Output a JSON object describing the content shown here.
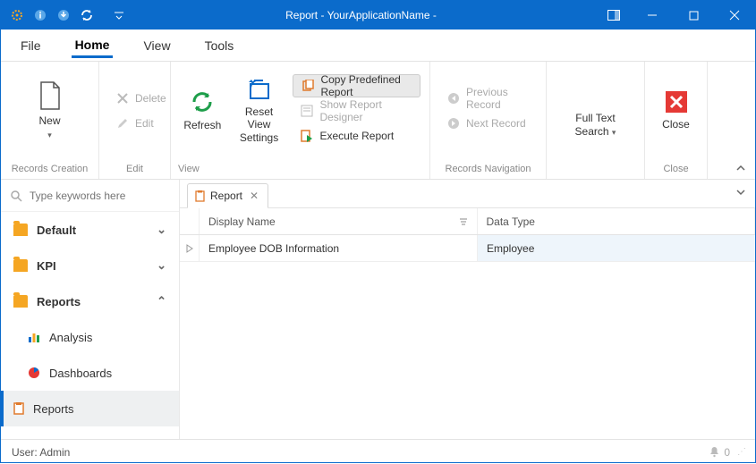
{
  "title": "Report - YourApplicationName -",
  "menubar": {
    "items": [
      "File",
      "Home",
      "View",
      "Tools"
    ],
    "active": "Home"
  },
  "ribbon": {
    "groups": {
      "records_creation": {
        "label": "Records Creation",
        "new": "New"
      },
      "edit": {
        "label": "Edit",
        "delete": "Delete",
        "edit_btn": "Edit"
      },
      "view": {
        "label": "View",
        "refresh": "Refresh",
        "reset_view": "Reset View Settings",
        "copy_predef": "Copy Predefined Report",
        "show_designer": "Show Report Designer",
        "execute": "Execute Report"
      },
      "records_nav": {
        "label": "Records Navigation",
        "prev": "Previous Record",
        "next": "Next Record"
      },
      "search": {
        "fulltext": "Full Text Search"
      },
      "close": {
        "label": "Close",
        "close_btn": "Close"
      }
    }
  },
  "sidebar": {
    "search_placeholder": "Type keywords here",
    "groups": [
      {
        "label": "Default"
      },
      {
        "label": "KPI"
      },
      {
        "label": "Reports",
        "expanded": true,
        "children": [
          {
            "label": "Analysis"
          },
          {
            "label": "Dashboards"
          },
          {
            "label": "Reports",
            "selected": true
          }
        ]
      }
    ]
  },
  "tab": {
    "title": "Report"
  },
  "grid": {
    "columns": [
      "Display Name",
      "Data Type"
    ],
    "rows": [
      {
        "display_name": "Employee DOB Information",
        "data_type": "Employee"
      }
    ]
  },
  "status": {
    "user": "User: Admin",
    "notif_count": "0"
  }
}
